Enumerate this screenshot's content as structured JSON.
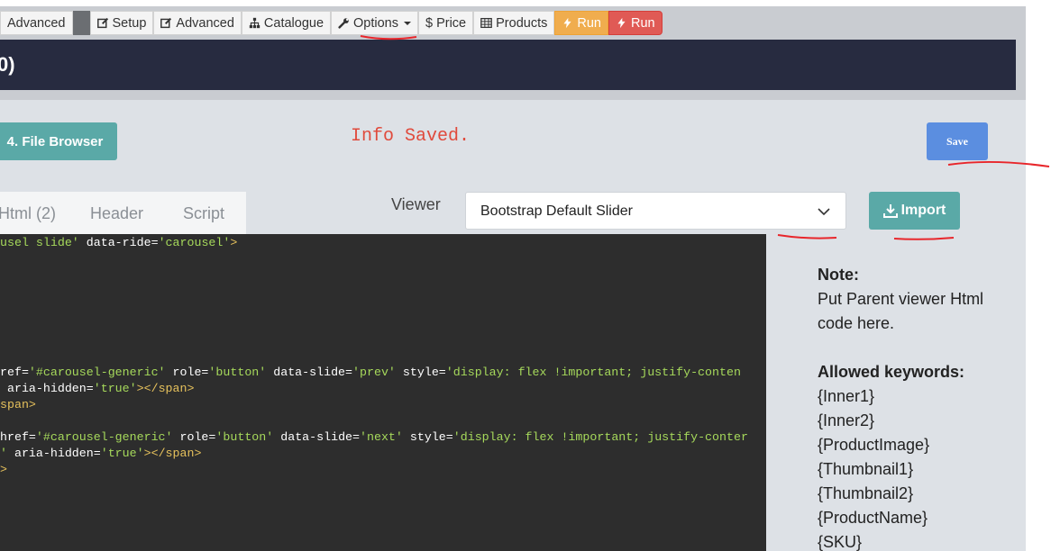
{
  "toolbar": {
    "items": [
      {
        "label": "Advanced",
        "icon": "none"
      },
      {
        "label": "Setup",
        "icon": "edit-icon"
      },
      {
        "label": "Advanced",
        "icon": "edit-icon"
      },
      {
        "label": "Catalogue",
        "icon": "sitemap-icon"
      },
      {
        "label": "Options",
        "icon": "wrench-icon"
      },
      {
        "label": "Price",
        "icon": "dollar-icon"
      },
      {
        "label": "Products",
        "icon": "table-icon"
      },
      {
        "label": "Run",
        "icon": "bolt-icon"
      },
      {
        "label": "Run",
        "icon": "bolt-icon"
      }
    ],
    "dollar_glyph": "$"
  },
  "title_bar": {
    "text": "0)"
  },
  "main": {
    "file_browser_label": "4. File Browser",
    "info_saved": "Info Saved.",
    "save_label": "Save",
    "tabs": [
      {
        "label": "Html (2)"
      },
      {
        "label": "Header"
      },
      {
        "label": "Script"
      }
    ],
    "viewer_label": "Viewer",
    "viewer_value": "Bootstrap Default Slider",
    "import_label": "Import"
  },
  "editor": {
    "lines": {
      "l1": {
        "p1": "usel slide",
        "p2": "'",
        "p3": " data-ride=",
        "p4": "'carousel'",
        "p5": ">"
      },
      "l2": {
        "p1": "ref=",
        "p2": "'#carousel-generic'",
        "p3": " role=",
        "p4": "'button'",
        "p5": " data-slide=",
        "p6": "'prev'",
        "p7": " style=",
        "p8": "'display: flex !important; justify-conten"
      },
      "l3": {
        "p1": " aria-hidden=",
        "p2": "'true'",
        "p3": "></span>"
      },
      "l4": {
        "p1": "span>"
      },
      "l5": {
        "p1": "href=",
        "p2": "'#carousel-generic'",
        "p3": " role=",
        "p4": "'button'",
        "p5": " data-slide=",
        "p6": "'next'",
        "p7": " style=",
        "p8": "'display: flex !important; justify-conter"
      },
      "l6": {
        "p1": "'",
        "p2": " aria-hidden=",
        "p3": "'true'",
        "p4": "></span>"
      },
      "l7": {
        "p1": ">"
      }
    }
  },
  "note": {
    "heading": "Note:",
    "text": "Put Parent viewer Html code here.",
    "keywords_heading": "Allowed keywords:",
    "keywords": [
      "{Inner1}",
      "{Inner2}",
      "{ProductImage}",
      "{Thumbnail1}",
      "{Thumbnail2}",
      "{ProductName}",
      "{SKU}"
    ]
  },
  "colors": {
    "accent_teal": "#5aa9a7",
    "save_blue": "#5b8ee0",
    "title_bar": "#272b40",
    "run_orange": "#f0ad4e",
    "run_red": "#e05a55",
    "info_red": "#e04a3c",
    "annotation_red": "#e8262b"
  }
}
